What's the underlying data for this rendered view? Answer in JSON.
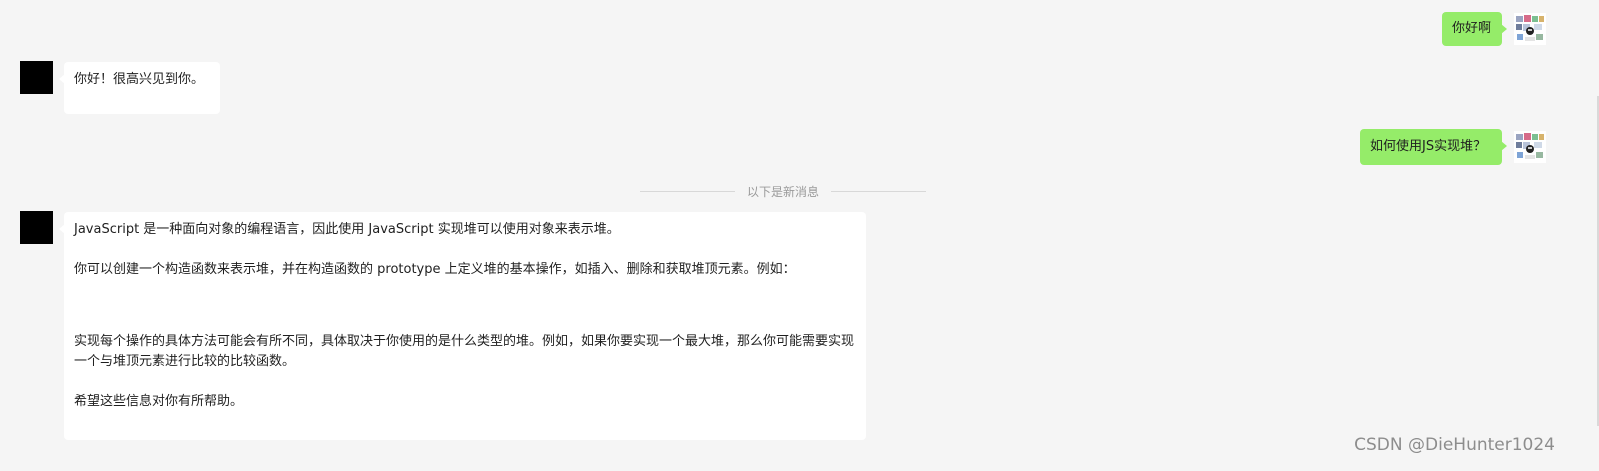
{
  "messages": [
    {
      "role": "user",
      "text": "你好啊"
    },
    {
      "role": "assistant",
      "text": "你好！很高兴见到你。"
    },
    {
      "role": "user",
      "text": "如何使用JS实现堆？"
    },
    {
      "role": "assistant",
      "paragraphs": [
        "JavaScript 是一种面向对象的编程语言，因此使用 JavaScript 实现堆可以使用对象来表示堆。",
        "你可以创建一个构造函数来表示堆，并在构造函数的 prototype 上定义堆的基本操作，如插入、删除和获取堆顶元素。例如：",
        "实现每个操作的具体方法可能会有所不同，具体取决于你使用的是什么类型的堆。例如，如果你要实现一个最大堆，那么你可能需要实现一个与堆顶元素进行比较的比较函数。",
        "希望这些信息对你有所帮助。"
      ]
    }
  ],
  "divider": {
    "text": "以下是新消息"
  },
  "watermark": "CSDN @DieHunter1024",
  "colors": {
    "background": "#f5f5f5",
    "user_bubble": "#95ec69",
    "assistant_bubble": "#ffffff",
    "assistant_avatar": "#000000"
  },
  "icons": {
    "user_avatar": "user-avatar-icon",
    "assistant_avatar": "assistant-avatar-icon"
  }
}
